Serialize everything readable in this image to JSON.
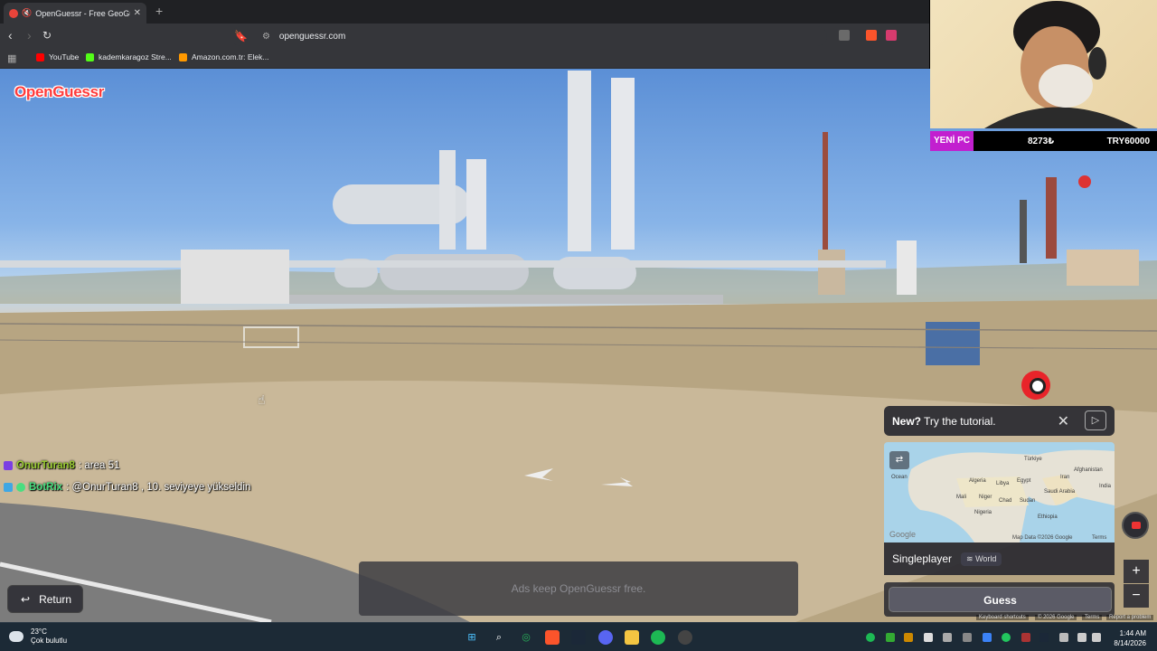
{
  "browser": {
    "tab_title": "OpenGuessr - Free GeoGuess",
    "new_tab": "+",
    "url": "openguessr.com",
    "bookmarks": [
      {
        "label": "YouTube",
        "color": "#ff0000"
      },
      {
        "label": "kademkaragoz Stre...",
        "color": "#53fc18"
      },
      {
        "label": "Amazon.com.tr: Elek...",
        "color": "#ff9900"
      }
    ]
  },
  "game": {
    "logo": "OpenGuessr",
    "return_label": "Return",
    "ads_text": "Ads keep OpenGuessr free.",
    "tutorial": {
      "bold": "New?",
      "text": "Try the tutorial."
    },
    "mode": "Singleplayer",
    "map_scope": "World",
    "guess_label": "Guess",
    "map_labels": {
      "turkiye": "Türkiye",
      "afghanistan": "Afghanistan",
      "iran": "Iran",
      "ocean": "Ocean",
      "algeria": "Algeria",
      "libya": "Libya",
      "egypt": "Egypt",
      "mali": "Mali",
      "niger": "Niger",
      "chad": "Chad",
      "sudan": "Sudan",
      "saudi": "Saudi Arabia",
      "nigeria": "Nigeria",
      "ethiopia": "Ethiopia",
      "india": "India"
    },
    "map_footer": {
      "data": "Map Data ©2026 Google",
      "terms": "Terms",
      "google": "Google"
    },
    "sv_footer": {
      "shortcuts": "Keyboard shortcuts",
      "data": "© 2026 Google",
      "terms": "Terms",
      "report": "Report a problem"
    }
  },
  "stream": {
    "tag": "YENİ PC",
    "value1": "8273₺",
    "value2": "TRY60000",
    "chat": [
      {
        "user": "OnurTuran8",
        "message": ": area 51",
        "color": "#9acd32"
      },
      {
        "user": "BotRix",
        "message": ": @OnurTuran8 , 10. seviyeye yükseldin",
        "color": "#4ade80",
        "mention_color": "#9b8cff"
      }
    ]
  },
  "taskbar": {
    "temperature": "23°C",
    "weather": "Çok bulutlu",
    "time": "1:44 AM",
    "date": "8/14/2026"
  }
}
